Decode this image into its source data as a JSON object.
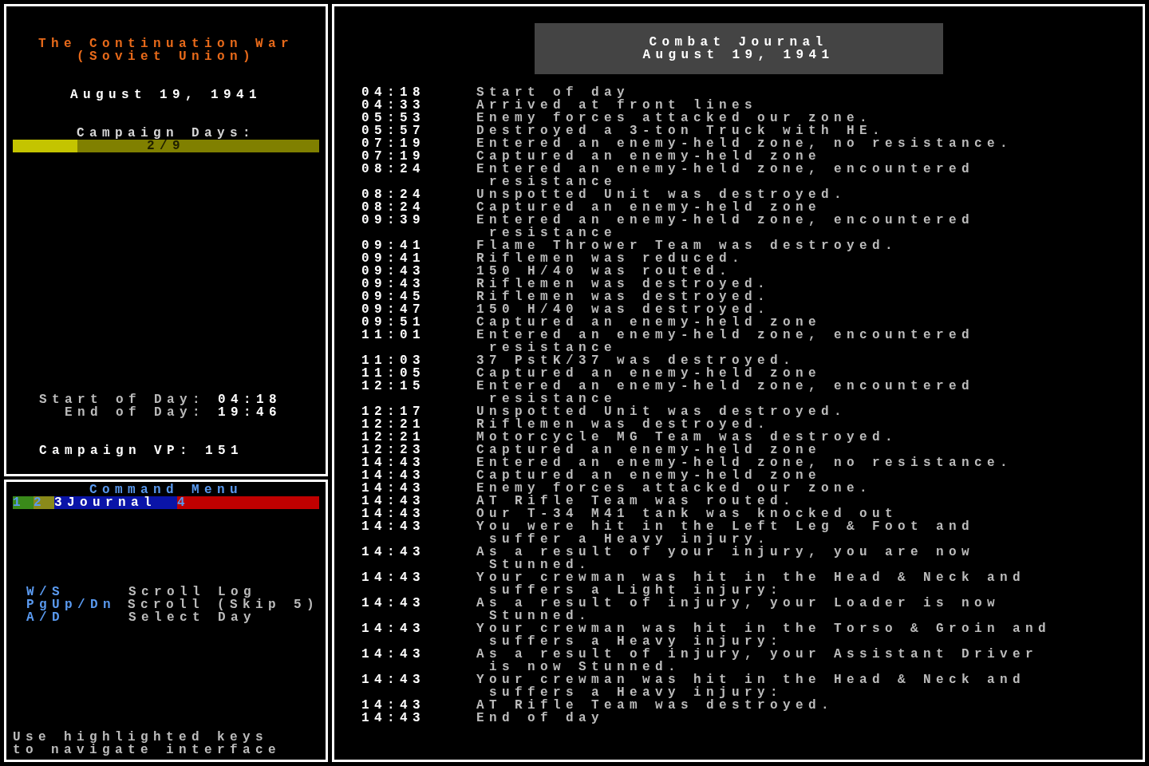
{
  "campaign": {
    "title": [
      "The Continuation War",
      "(Soviet Union)"
    ],
    "date": "August 19, 1941",
    "days_label": "Campaign Days:",
    "days_bar": {
      "level": 0.21,
      "reading": "2/9"
    },
    "start_label": "Start of Day:",
    "start_time": "04:18",
    "end_label": "End of Day:",
    "end_time": "19:46",
    "vp_label": "Campaign VP:",
    "vp_value": "151"
  },
  "command_menu": {
    "title": "Command Menu",
    "tabs": [
      {
        "key": "1",
        "selected": false,
        "color": "#3a8a1a"
      },
      {
        "key": "2",
        "selected": false,
        "color": "#8a8a1a"
      },
      {
        "key": "3",
        "label": "Journal",
        "selected": true,
        "color": "#0a14a8"
      },
      {
        "key": "4",
        "selected": false,
        "color": "#c00000"
      }
    ],
    "keys": [
      {
        "key": "W/S",
        "action": "Scroll Log"
      },
      {
        "key": "PgUp/Dn",
        "action": "Scroll (Skip 5)"
      },
      {
        "key": "A/D",
        "action": "Select Day"
      }
    ],
    "hint": [
      "Use highlighted keys",
      "to navigate interface"
    ]
  },
  "journal": {
    "title": [
      "Combat Journal",
      "August 19, 1941"
    ],
    "entries": [
      {
        "time": "04:18",
        "text": "Start of day"
      },
      {
        "time": "04:33",
        "text": "Arrived at front lines"
      },
      {
        "time": "05:53",
        "text": "Enemy forces attacked our zone."
      },
      {
        "time": "05:57",
        "text": "Destroyed a 3-ton Truck with HE."
      },
      {
        "time": "07:19",
        "text": "Entered an enemy-held zone, no resistance."
      },
      {
        "time": "07:19",
        "text": "Captured an enemy-held zone"
      },
      {
        "time": "08:24",
        "text": "Entered an enemy-held zone, encountered resistance"
      },
      {
        "time": "08:24",
        "text": "Unspotted Unit was destroyed."
      },
      {
        "time": "08:24",
        "text": "Captured an enemy-held zone"
      },
      {
        "time": "09:39",
        "text": "Entered an enemy-held zone, encountered resistance"
      },
      {
        "time": "09:41",
        "text": "Flame Thrower Team was destroyed."
      },
      {
        "time": "09:41",
        "text": "Riflemen was reduced."
      },
      {
        "time": "09:43",
        "text": "150 H/40 was routed."
      },
      {
        "time": "09:43",
        "text": "Riflemen was destroyed."
      },
      {
        "time": "09:45",
        "text": "Riflemen was destroyed."
      },
      {
        "time": "09:47",
        "text": "150 H/40 was destroyed."
      },
      {
        "time": "09:51",
        "text": "Captured an enemy-held zone"
      },
      {
        "time": "11:01",
        "text": "Entered an enemy-held zone, encountered resistance"
      },
      {
        "time": "11:03",
        "text": "37 PstK/37 was destroyed."
      },
      {
        "time": "11:05",
        "text": "Captured an enemy-held zone"
      },
      {
        "time": "12:15",
        "text": "Entered an enemy-held zone, encountered resistance"
      },
      {
        "time": "12:17",
        "text": "Unspotted Unit was destroyed."
      },
      {
        "time": "12:21",
        "text": "Riflemen was destroyed."
      },
      {
        "time": "12:21",
        "text": "Motorcycle MG Team was destroyed."
      },
      {
        "time": "12:23",
        "text": "Captured an enemy-held zone"
      },
      {
        "time": "14:43",
        "text": "Entered an enemy-held zone, no resistance."
      },
      {
        "time": "14:43",
        "text": "Captured an enemy-held zone"
      },
      {
        "time": "14:43",
        "text": "Enemy forces attacked our zone."
      },
      {
        "time": "14:43",
        "text": "AT Rifle Team was routed."
      },
      {
        "time": "14:43",
        "text": "Our T-34 M41 tank was knocked out"
      },
      {
        "time": "14:43",
        "text": "You were hit in the Left Leg & Foot and suffer a Heavy injury."
      },
      {
        "time": "14:43",
        "text": "As a result of your injury, you are now Stunned."
      },
      {
        "time": "14:43",
        "text": "Your crewman was hit in the Head & Neck and suffers a Light injury:"
      },
      {
        "time": "14:43",
        "text": "As a result of injury, your Loader is now Stunned."
      },
      {
        "time": "14:43",
        "text": "Your crewman was hit in the Torso & Groin and suffers a Heavy injury:"
      },
      {
        "time": "14:43",
        "text": "As a result of injury, your Assistant Driver is now Stunned."
      },
      {
        "time": "14:43",
        "text": "Your crewman was hit in the Head & Neck and suffers a Heavy injury:"
      },
      {
        "time": "14:43",
        "text": "AT Rifle Team was destroyed."
      },
      {
        "time": "14:43",
        "text": "End of day"
      }
    ]
  }
}
